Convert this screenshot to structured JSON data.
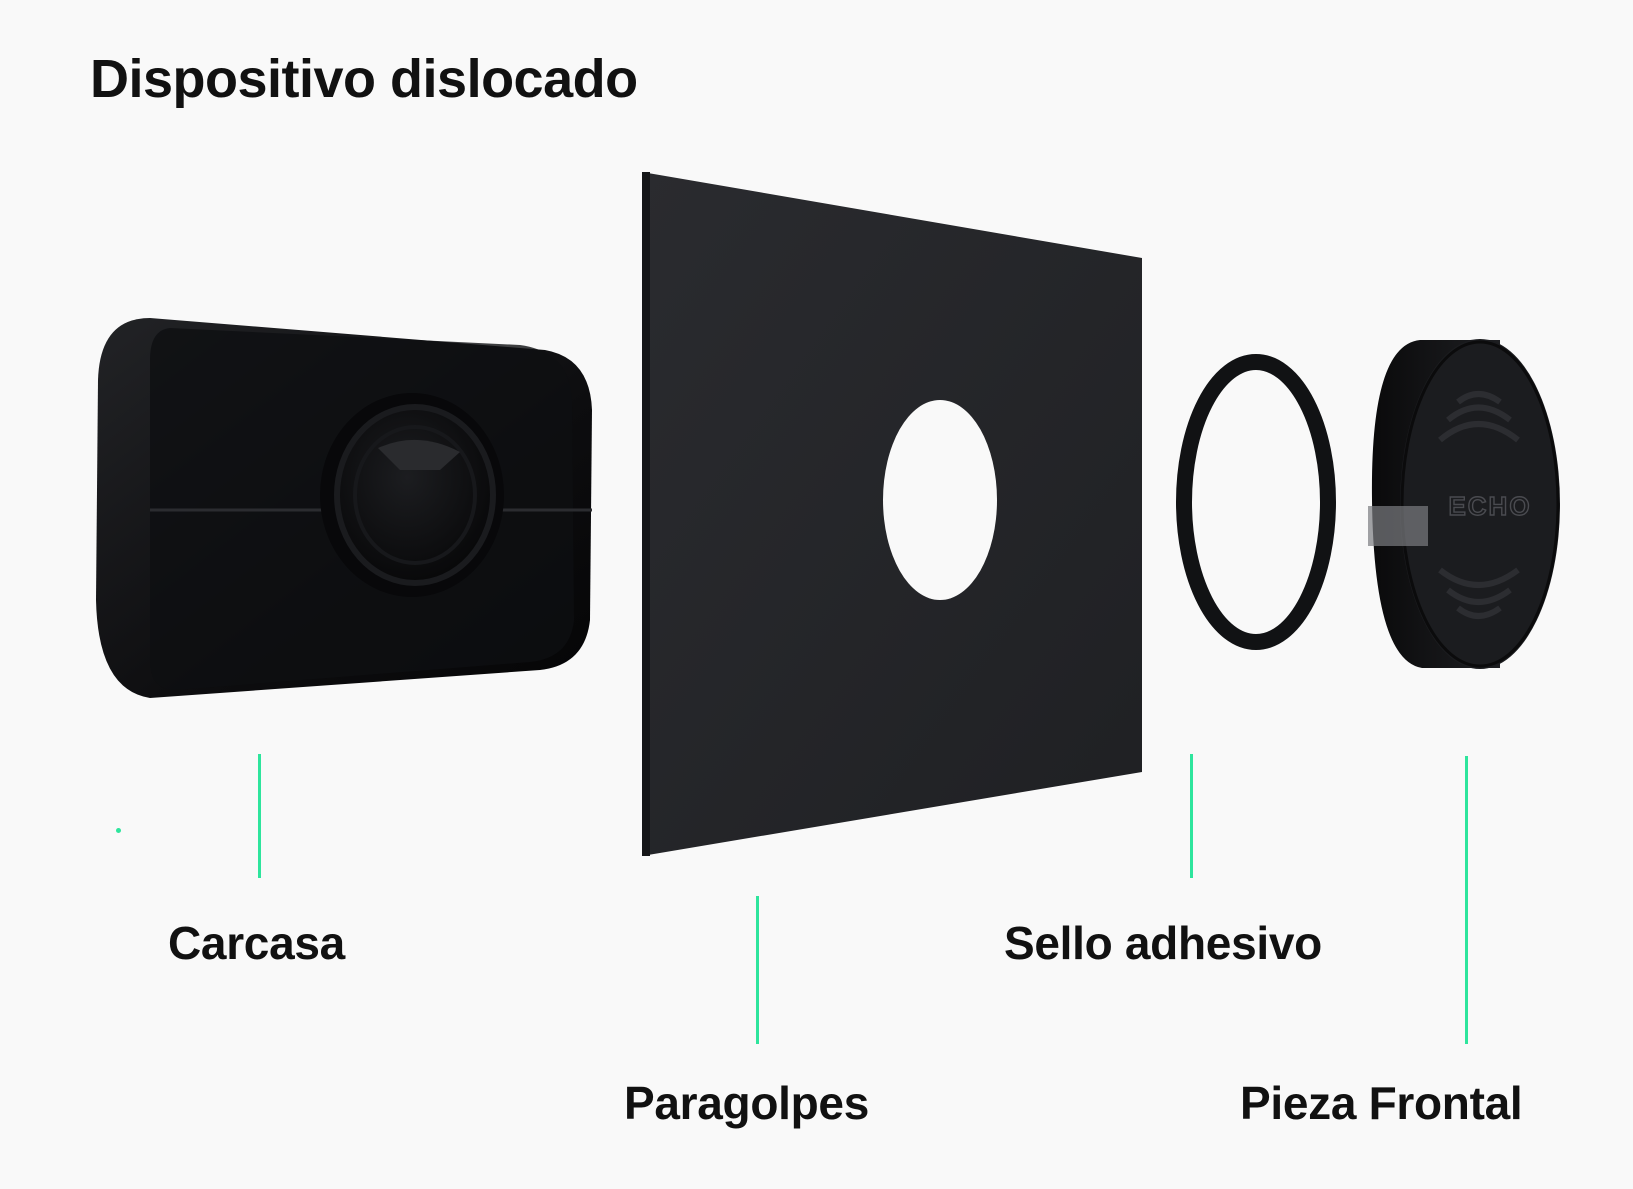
{
  "title": "Dispositivo dislocado",
  "parts": [
    {
      "id": "carcasa",
      "label": "Carcasa"
    },
    {
      "id": "paragolpes",
      "label": "Paragolpes"
    },
    {
      "id": "sello",
      "label": "Sello adhesivo"
    },
    {
      "id": "frontal",
      "label": "Pieza Frontal"
    }
  ],
  "front_logo_text": "ECHO",
  "colors": {
    "background": "#f9f9f9",
    "accent": "#2ee59d",
    "part_dark": "#1b1c1f",
    "text": "#111111"
  }
}
